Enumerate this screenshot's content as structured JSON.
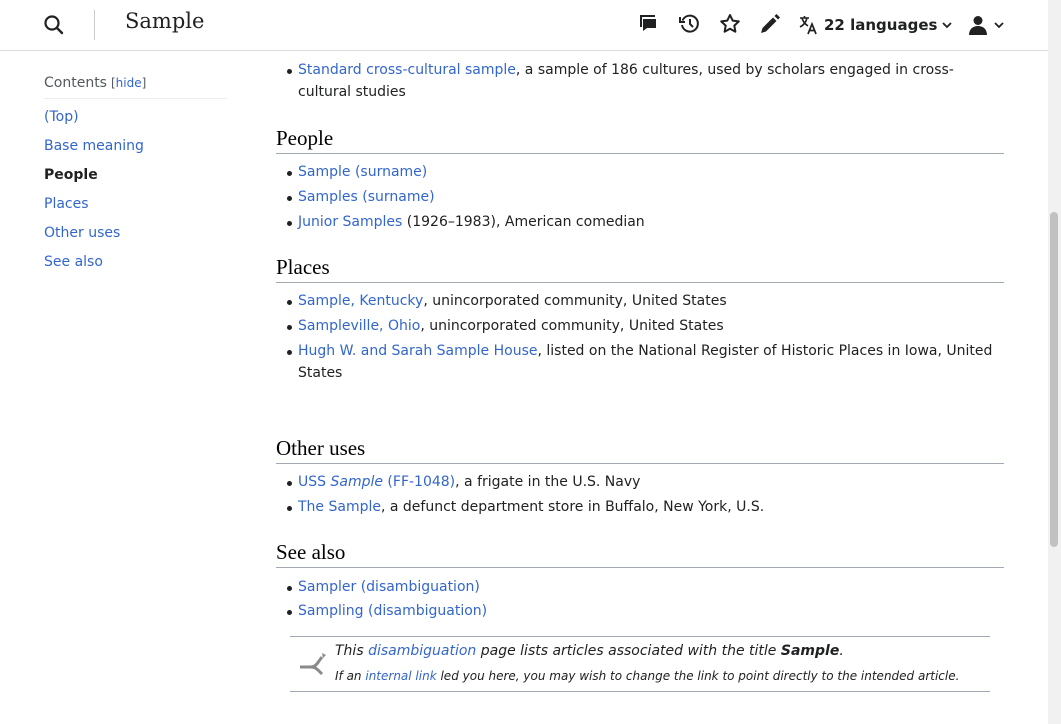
{
  "header": {
    "title": "Sample",
    "languages_label": "22 languages",
    "icons": [
      "search-icon",
      "talk-icon",
      "history-icon",
      "watch-star-icon",
      "edit-pencil-icon",
      "language-icon",
      "user-icon"
    ]
  },
  "toc": {
    "title": "Contents",
    "bracket_open": "[",
    "hide_label": "hide",
    "bracket_close": "]",
    "items": [
      {
        "label": "(Top)",
        "active": false
      },
      {
        "label": "Base meaning",
        "active": false
      },
      {
        "label": "People",
        "active": true
      },
      {
        "label": "Places",
        "active": false
      },
      {
        "label": "Other uses",
        "active": false
      },
      {
        "label": "See also",
        "active": false
      }
    ]
  },
  "content": {
    "top_item": {
      "link": "Standard cross-cultural sample",
      "text_line1": ", a sample of 186 cultures, used by scholars engaged in cross-",
      "text_line2": "cultural studies"
    },
    "people": {
      "heading": "People",
      "items": [
        {
          "link": "Sample (surname)",
          "text": ""
        },
        {
          "link": "Samples (surname)",
          "text": ""
        },
        {
          "link": "Junior Samples",
          "text": " (1926–1983), American comedian"
        }
      ]
    },
    "places": {
      "heading": "Places",
      "items": [
        {
          "link": "Sample, Kentucky",
          "text": ", unincorporated community, United States"
        },
        {
          "link": "Sampleville, Ohio",
          "text": ", unincorporated community, United States"
        },
        {
          "link": "Hugh W. and Sarah Sample House",
          "text": ", listed on the National Register of Historic Places in Iowa, United",
          "text2": "States"
        }
      ]
    },
    "other_uses": {
      "heading": "Other uses",
      "items": [
        {
          "link_prefix": "USS ",
          "link_italic": "Sample",
          "link_suffix": " (FF-1048)",
          "text": ", a frigate in the U.S. Navy"
        },
        {
          "link": "The Sample",
          "text": ", a defunct department store in Buffalo, New York, U.S."
        }
      ]
    },
    "see_also": {
      "heading": "See also",
      "items": [
        {
          "link": "Sampler (disambiguation)"
        },
        {
          "link": "Sampling (disambiguation)"
        }
      ]
    },
    "disambig": {
      "pre": "This ",
      "link": "disambiguation",
      "mid": " page lists articles associated with the title ",
      "title": "Sample",
      "end": ".",
      "line2_pre": "If an ",
      "line2_link": "internal link",
      "line2_post": " led you here, you may wish to change the link to point directly to the intended article."
    }
  },
  "colors": {
    "link": "#3366cc",
    "text": "#202122",
    "border": "#a2a9b1"
  }
}
